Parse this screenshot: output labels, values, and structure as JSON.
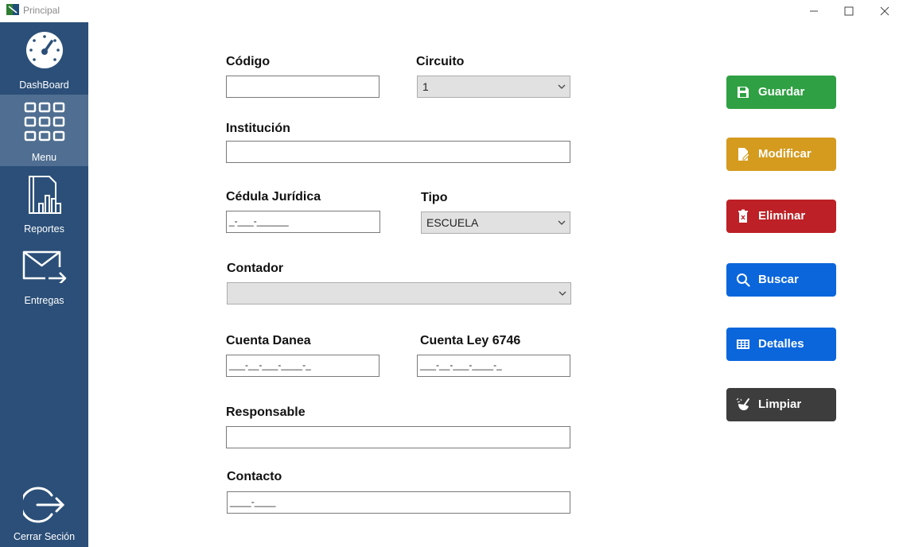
{
  "window": {
    "title": "Principal"
  },
  "sidebar": {
    "items": [
      {
        "label": "DashBoard",
        "icon": "dashboard-gauge-icon"
      },
      {
        "label": "Menu",
        "icon": "grid-menu-icon",
        "active": true
      },
      {
        "label": "Reportes",
        "icon": "reports-chart-icon"
      },
      {
        "label": "Entregas",
        "icon": "mail-send-icon"
      }
    ],
    "logout": {
      "label": "Cerrar Seción",
      "icon": "logout-icon"
    }
  },
  "form": {
    "codigo": {
      "label": "Código",
      "value": ""
    },
    "circuito": {
      "label": "Circuito",
      "selected": "1"
    },
    "institucion": {
      "label": "Institución",
      "value": ""
    },
    "cedula": {
      "label": "Cédula Jurídica",
      "value": "_-___-______"
    },
    "tipo": {
      "label": "Tipo",
      "selected": "ESCUELA"
    },
    "contador": {
      "label": "Contador",
      "selected": ""
    },
    "cuenta_danea": {
      "label": "Cuenta Danea",
      "value": "___-__-___-____-_"
    },
    "cuenta_ley": {
      "label": "Cuenta Ley 6746",
      "value": "___-__-___-____-_"
    },
    "responsable": {
      "label": "Responsable",
      "value": ""
    },
    "contacto": {
      "label": "Contacto",
      "value": "____-____"
    }
  },
  "actions": {
    "guardar": {
      "label": "Guardar",
      "color": "#2fa043",
      "icon": "save-icon"
    },
    "modificar": {
      "label": "Modificar",
      "color": "#d49b1f",
      "icon": "edit-document-icon"
    },
    "eliminar": {
      "label": "Eliminar",
      "color": "#bd2026",
      "icon": "trash-icon"
    },
    "buscar": {
      "label": "Buscar",
      "color": "#0b66dc",
      "icon": "search-icon"
    },
    "detalles": {
      "label": "Detalles",
      "color": "#0b66dc",
      "icon": "table-icon"
    },
    "limpiar": {
      "label": "Limpiar",
      "color": "#3d3d3d",
      "icon": "broom-icon"
    }
  },
  "colors": {
    "sidebar": "#2b4f78",
    "sidebar_active": "#4f6e91"
  }
}
